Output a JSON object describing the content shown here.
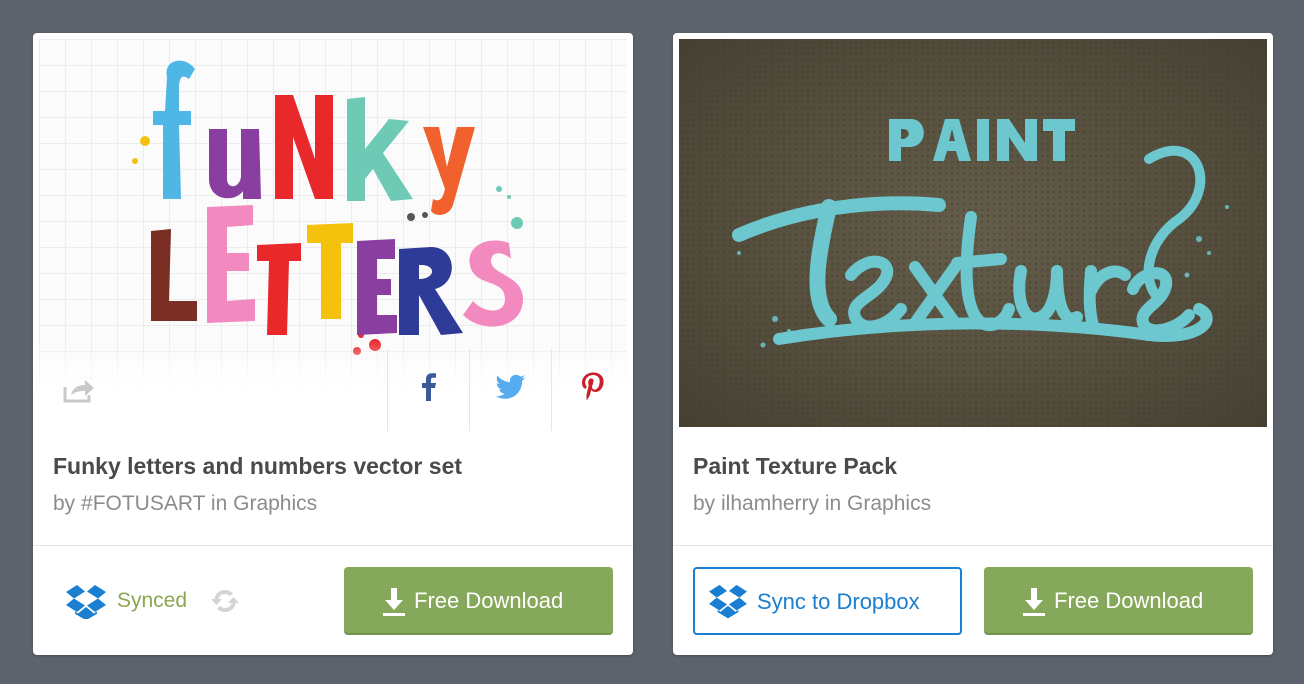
{
  "cards": [
    {
      "title": "Funky letters and numbers vector set",
      "byline": "by #FOTUSART in Graphics",
      "preview_icon": "funky-letters-artwork",
      "share": {
        "share_icon": "share-arrow-icon",
        "facebook_icon": "facebook-icon",
        "twitter_icon": "twitter-icon",
        "pinterest_icon": "pinterest-icon"
      },
      "sync_status": {
        "label": "Synced",
        "icon": "dropbox-icon",
        "status_icon": "refresh-icon"
      },
      "download_label": "Free Download"
    },
    {
      "title": "Paint Texture Pack",
      "byline": "by ilhamherry in Graphics",
      "preview_icon": "paint-texture-artwork",
      "sync_button_label": "Sync to Dropbox",
      "download_label": "Free Download"
    }
  ],
  "colors": {
    "page_bg": "#5d636c",
    "download_green": "#86a85a",
    "dropbox_blue": "#1a7fd0",
    "synced_green": "#8ba64f",
    "facebook_blue": "#3b5998",
    "twitter_blue": "#55acee",
    "pinterest_red": "#cb2027"
  }
}
